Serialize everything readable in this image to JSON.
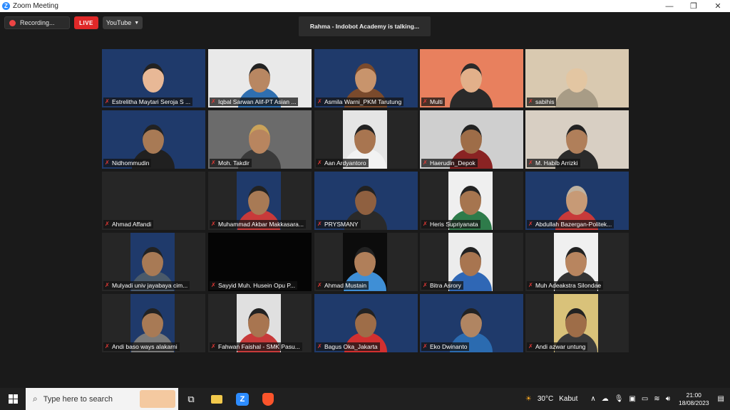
{
  "window": {
    "title": "Zoom Meeting",
    "minimize": "—",
    "restore": "❐",
    "close": "✕"
  },
  "toolbar": {
    "recording_label": "Recording...",
    "live_label": "LIVE",
    "stream_target": "YouTube"
  },
  "speaker": {
    "text": "Rahma - Indobot Academy is talking..."
  },
  "participants": [
    {
      "name": "Estrelitha Maytari Seroja S ...",
      "bg": "#1f3a6b",
      "skin": "#e8b896",
      "shirt": "#1f3a6b",
      "hair": "#222"
    },
    {
      "name": "Iqbal Sarwan Alif-PT Asian ...",
      "bg": "#e9e9e9",
      "skin": "#b88762",
      "shirt": "#2f6fb0",
      "hair": "#222"
    },
    {
      "name": "Asmila Warni_PKM Tarutung",
      "bg": "#1f3a6b",
      "skin": "#c8946c",
      "shirt": "#7a4a2c",
      "hair": "#7a4a2c"
    },
    {
      "name": "Multi",
      "bg": "#e8805e",
      "skin": "#e2b08a",
      "shirt": "#2a2a2a",
      "hair": "#2a2a2a"
    },
    {
      "name": "sabihis",
      "bg": "#d9c9b0",
      "skin": "#e3c6a2",
      "shirt": "#a89c86",
      "hair": "#d9c9b0"
    },
    {
      "name": "Nidhommudin",
      "bg": "#1f3a6b",
      "skin": "#a87a55",
      "shirt": "#202020",
      "hair": "#222"
    },
    {
      "name": "Moh. Takdir",
      "bg": "#6b6b6b",
      "skin": "#b8855f",
      "shirt": "#3a3a3a",
      "hair": "#caa35a"
    },
    {
      "name": "Aan Ardyantoro",
      "bg": "#e5e5e5",
      "skin": "#a87550",
      "shirt": "#f2f2f2",
      "hair": "#222"
    },
    {
      "name": "Haerudin_Depok",
      "bg": "#cfcfcf",
      "skin": "#9e6d48",
      "shirt": "#8a2323",
      "hair": "#222"
    },
    {
      "name": "M. Habib Arrizki",
      "bg": "#d8cfc3",
      "skin": "#b07f5a",
      "shirt": "#2a2a2a",
      "hair": "#222"
    },
    {
      "name": "Ahmad Affandi",
      "bg": "#262626",
      "skin": "#262626",
      "shirt": "#262626",
      "hair": "#262626"
    },
    {
      "name": "Muhammad Akbar Makkasara...",
      "bg": "#1f3a6b",
      "skin": "#a87a55",
      "shirt": "#c83a3a",
      "hair": "#222"
    },
    {
      "name": "PRYSMANY",
      "bg": "#1f3a6b",
      "skin": "#8f6040",
      "shirt": "#2a2a2a",
      "hair": "#222"
    },
    {
      "name": "Heris Supriyanata",
      "bg": "#efefef",
      "skin": "#a6754f",
      "shirt": "#2e7b4a",
      "hair": "#222"
    },
    {
      "name": "Abdullah Bazergan-Politek...",
      "bg": "#1f3a6b",
      "skin": "#c79a76",
      "shirt": "#c83a3a",
      "hair": "#bfb2a0"
    },
    {
      "name": "Mulyadi univ jayabaya cim...",
      "bg": "#1f3a6b",
      "skin": "#a87a55",
      "shirt": "#4a5a6a",
      "hair": "#222"
    },
    {
      "name": "Sayyid Muh. Husein Opu P...",
      "bg": "#050505",
      "skin": "#050505",
      "shirt": "#050505",
      "hair": "#050505"
    },
    {
      "name": "Ahmad Mustain",
      "bg": "#0c0c0c",
      "skin": "#b07f5a",
      "shirt": "#3f8fd6",
      "hair": "#222"
    },
    {
      "name": "Bitra Asrory",
      "bg": "#ececec",
      "skin": "#a87550",
      "shirt": "#2f67b5",
      "hair": "#222"
    },
    {
      "name": "Muh Adeakstra Silondae",
      "bg": "#f0f0f0",
      "skin": "#b8855f",
      "shirt": "#333",
      "hair": "#222"
    },
    {
      "name": "Andi baso ways alakarni",
      "bg": "#1f3a6b",
      "skin": "#a87a55",
      "shirt": "#7a7a7a",
      "hair": "#222"
    },
    {
      "name": "Fahwan Faishal - SMK Pasu...",
      "bg": "#e0e0e0",
      "skin": "#a87550",
      "shirt": "#c83a3a",
      "hair": "#222"
    },
    {
      "name": "Bagus Oka_Jakarta",
      "bg": "#1f3a6b",
      "skin": "#9e6d48",
      "shirt": "#d23030",
      "hair": "#222"
    },
    {
      "name": "Eko Dwinanto",
      "bg": "#1f3a6b",
      "skin": "#b08562",
      "shirt": "#2b6bb0",
      "hair": "#222"
    },
    {
      "name": "Andi azwar untung",
      "bg": "#d9c27a",
      "skin": "#9e6d48",
      "shirt": "#3a3a3a",
      "hair": "#222"
    }
  ],
  "taskbar": {
    "search_placeholder": "Type here to search",
    "weather_temp": "30°C",
    "weather_desc": "Kabut",
    "time": "21:00",
    "date": "18/08/2023"
  }
}
